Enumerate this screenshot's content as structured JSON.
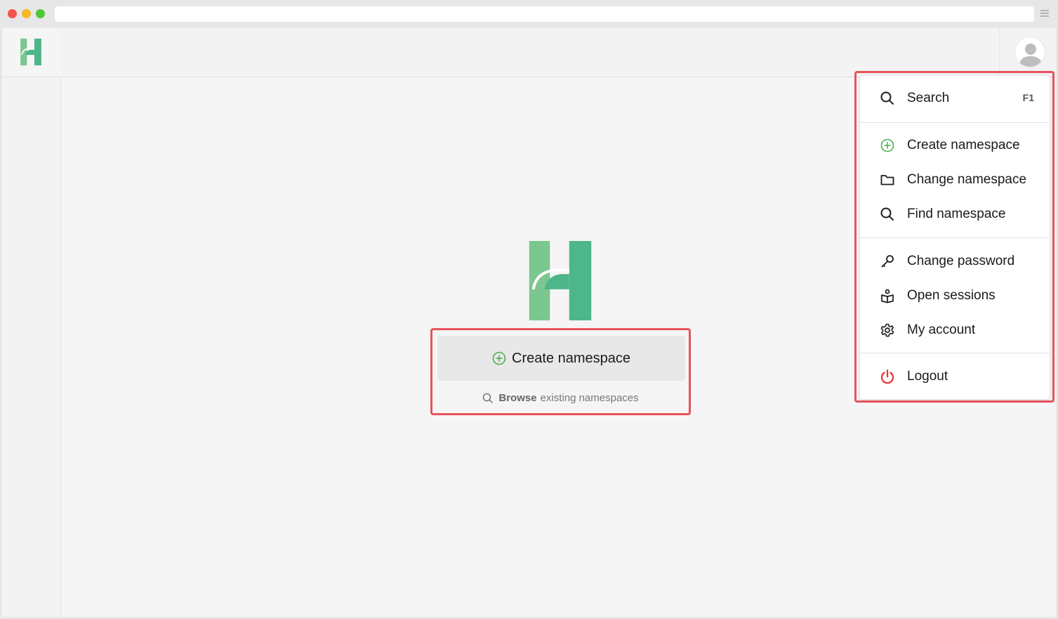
{
  "menu": {
    "search": {
      "label": "Search",
      "shortcut": "F1"
    },
    "create_namespace": "Create namespace",
    "change_namespace": "Change namespace",
    "find_namespace": "Find namespace",
    "change_password": "Change password",
    "open_sessions": "Open sessions",
    "my_account": "My account",
    "logout": "Logout"
  },
  "main": {
    "create_button_label": "Create namespace",
    "browse_bold": "Browse",
    "browse_rest": "existing namespaces"
  },
  "colors": {
    "accent_green": "#4db68a",
    "light_green": "#7cc68f",
    "highlight_red": "#e8525c",
    "logout_red": "#e53935"
  },
  "icons": {
    "notifications": "bell-icon",
    "user": "avatar-icon",
    "search": "search-icon",
    "create": "plus-circle-icon",
    "change": "folder-icon",
    "find": "search-icon",
    "password": "key-icon",
    "sessions": "sessions-icon",
    "account": "gear-icon",
    "logout": "power-icon"
  }
}
